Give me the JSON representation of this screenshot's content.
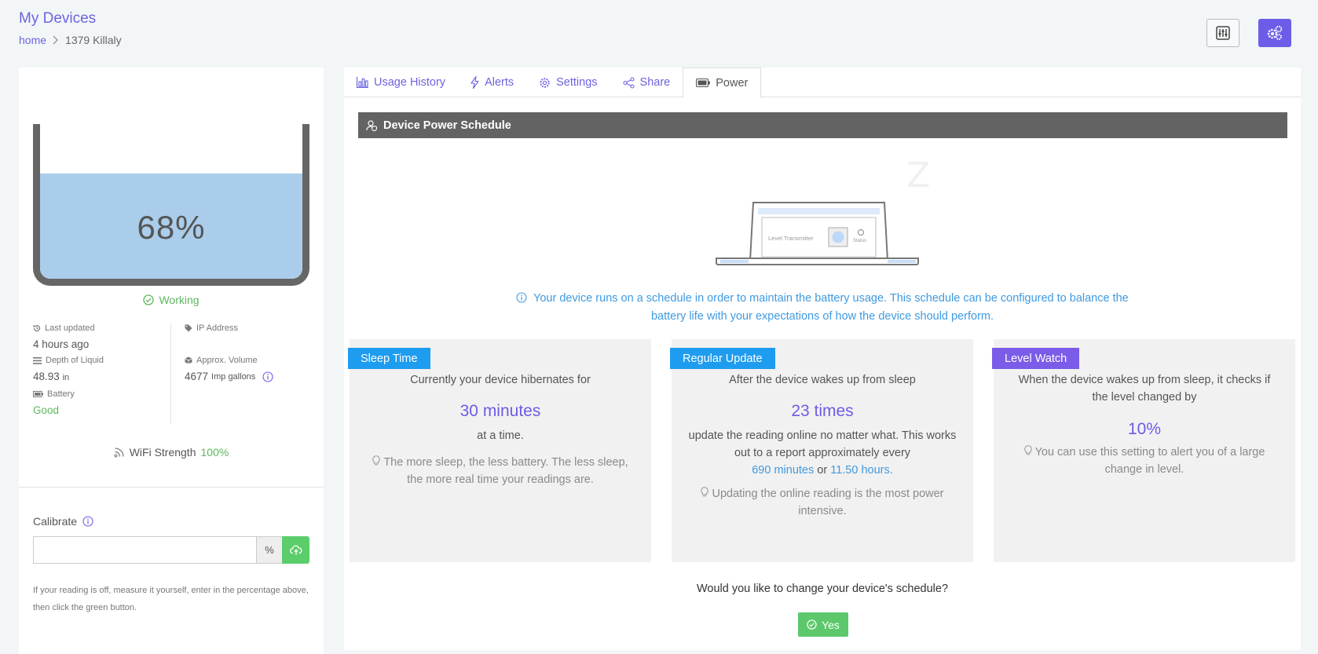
{
  "header": {
    "title": "My Devices",
    "breadcrumb": {
      "home": "home",
      "separator": ">",
      "current": "1379 Killaly"
    },
    "buttons": {
      "filter_icon": "sliders-icon",
      "settings_icon": "gears-icon"
    }
  },
  "device": {
    "level_percent": "68%",
    "level_fraction": 0.68,
    "status": "Working",
    "stats": {
      "last_updated_label": "Last updated",
      "last_updated_value": "4 hours ago",
      "ip_label": "IP Address",
      "ip_value": "",
      "depth_label": "Depth of Liquid",
      "depth_value": "48.93",
      "depth_unit": "in",
      "volume_label": "Approx. Volume",
      "volume_value": "4677",
      "volume_unit": "Imp gallons",
      "battery_label": "Battery",
      "battery_value": "Good"
    },
    "wifi": {
      "label": "WiFi Strength",
      "value": "100%"
    }
  },
  "calibrate": {
    "label": "Calibrate",
    "input_value": "",
    "addon": "%",
    "help": "If your reading is off, measure it yourself, enter in the percentage above, then click the green button."
  },
  "tabs": [
    {
      "label": "Usage History",
      "icon": "bar-chart-icon"
    },
    {
      "label": "Alerts",
      "icon": "bolt-icon"
    },
    {
      "label": "Settings",
      "icon": "gear-icon"
    },
    {
      "label": "Share",
      "icon": "share-icon"
    },
    {
      "label": "Power",
      "icon": "battery-icon"
    }
  ],
  "power": {
    "heading": "Device Power Schedule",
    "illustration": {
      "label": "Level Transmitter",
      "status_label": "Status",
      "sleep_letter": "Z"
    },
    "info": "Your device runs on a schedule in order to maintain the battery usage. This schedule can be configured to balance the battery life with your expectations of how the device should perform.",
    "cards": {
      "sleep": {
        "badge": "Sleep Time",
        "intro": "Currently your device hibernates for",
        "value": "30 minutes",
        "after": "at a time.",
        "tip": "The more sleep, the less battery. The less sleep, the more real time your readings are."
      },
      "regular": {
        "badge": "Regular Update",
        "intro": "After the device wakes up from sleep",
        "value": "23 times",
        "after": "update the reading online no matter what. This works out to a report approximately every",
        "minutes": "690 minutes",
        "or": "or",
        "hours": "11.50 hours.",
        "tip": "Updating the online reading is the most power intensive."
      },
      "level": {
        "badge": "Level Watch",
        "intro": "When the device wakes up from sleep, it checks if the level changed by",
        "value": "10%",
        "tip": "You can use this setting to alert you of a large change in level."
      }
    },
    "question": "Would you like to change your device's schedule?",
    "yes": "Yes"
  },
  "colors": {
    "accent": "#6c5ce7",
    "link": "#3f9ae0",
    "success": "#5cb85c",
    "sleep_badge": "#1e9cf0",
    "regular_badge": "#1e9cf0",
    "level_badge": "#7b5ce8",
    "tank_fill": "#aacdeb",
    "heading_bar": "#636363"
  }
}
